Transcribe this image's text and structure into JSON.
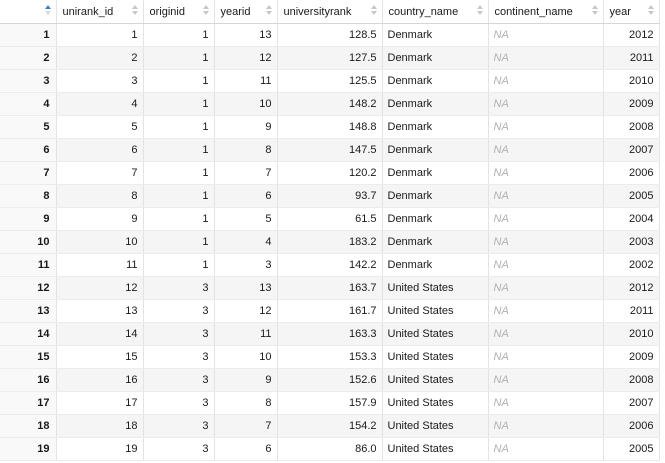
{
  "columns": [
    {
      "key": "unirank_id",
      "label": "unirank_id"
    },
    {
      "key": "originid",
      "label": "originid"
    },
    {
      "key": "yearid",
      "label": "yearid"
    },
    {
      "key": "universityrank",
      "label": "universityrank"
    },
    {
      "key": "country_name",
      "label": "country_name"
    },
    {
      "key": "continent_name",
      "label": "continent_name"
    },
    {
      "key": "year",
      "label": "year"
    }
  ],
  "rows": [
    {
      "idx": "1",
      "unirank_id": "1",
      "originid": "1",
      "yearid": "13",
      "universityrank": "128.5",
      "country_name": "Denmark",
      "continent_name": "NA",
      "year": "2012"
    },
    {
      "idx": "2",
      "unirank_id": "2",
      "originid": "1",
      "yearid": "12",
      "universityrank": "127.5",
      "country_name": "Denmark",
      "continent_name": "NA",
      "year": "2011"
    },
    {
      "idx": "3",
      "unirank_id": "3",
      "originid": "1",
      "yearid": "11",
      "universityrank": "125.5",
      "country_name": "Denmark",
      "continent_name": "NA",
      "year": "2010"
    },
    {
      "idx": "4",
      "unirank_id": "4",
      "originid": "1",
      "yearid": "10",
      "universityrank": "148.2",
      "country_name": "Denmark",
      "continent_name": "NA",
      "year": "2009"
    },
    {
      "idx": "5",
      "unirank_id": "5",
      "originid": "1",
      "yearid": "9",
      "universityrank": "148.8",
      "country_name": "Denmark",
      "continent_name": "NA",
      "year": "2008"
    },
    {
      "idx": "6",
      "unirank_id": "6",
      "originid": "1",
      "yearid": "8",
      "universityrank": "147.5",
      "country_name": "Denmark",
      "continent_name": "NA",
      "year": "2007"
    },
    {
      "idx": "7",
      "unirank_id": "7",
      "originid": "1",
      "yearid": "7",
      "universityrank": "120.2",
      "country_name": "Denmark",
      "continent_name": "NA",
      "year": "2006"
    },
    {
      "idx": "8",
      "unirank_id": "8",
      "originid": "1",
      "yearid": "6",
      "universityrank": "93.7",
      "country_name": "Denmark",
      "continent_name": "NA",
      "year": "2005"
    },
    {
      "idx": "9",
      "unirank_id": "9",
      "originid": "1",
      "yearid": "5",
      "universityrank": "61.5",
      "country_name": "Denmark",
      "continent_name": "NA",
      "year": "2004"
    },
    {
      "idx": "10",
      "unirank_id": "10",
      "originid": "1",
      "yearid": "4",
      "universityrank": "183.2",
      "country_name": "Denmark",
      "continent_name": "NA",
      "year": "2003"
    },
    {
      "idx": "11",
      "unirank_id": "11",
      "originid": "1",
      "yearid": "3",
      "universityrank": "142.2",
      "country_name": "Denmark",
      "continent_name": "NA",
      "year": "2002"
    },
    {
      "idx": "12",
      "unirank_id": "12",
      "originid": "3",
      "yearid": "13",
      "universityrank": "163.7",
      "country_name": "United States",
      "continent_name": "NA",
      "year": "2012"
    },
    {
      "idx": "13",
      "unirank_id": "13",
      "originid": "3",
      "yearid": "12",
      "universityrank": "161.7",
      "country_name": "United States",
      "continent_name": "NA",
      "year": "2011"
    },
    {
      "idx": "14",
      "unirank_id": "14",
      "originid": "3",
      "yearid": "11",
      "universityrank": "163.3",
      "country_name": "United States",
      "continent_name": "NA",
      "year": "2010"
    },
    {
      "idx": "15",
      "unirank_id": "15",
      "originid": "3",
      "yearid": "10",
      "universityrank": "153.3",
      "country_name": "United States",
      "continent_name": "NA",
      "year": "2009"
    },
    {
      "idx": "16",
      "unirank_id": "16",
      "originid": "3",
      "yearid": "9",
      "universityrank": "152.6",
      "country_name": "United States",
      "continent_name": "NA",
      "year": "2008"
    },
    {
      "idx": "17",
      "unirank_id": "17",
      "originid": "3",
      "yearid": "8",
      "universityrank": "157.9",
      "country_name": "United States",
      "continent_name": "NA",
      "year": "2007"
    },
    {
      "idx": "18",
      "unirank_id": "18",
      "originid": "3",
      "yearid": "7",
      "universityrank": "154.2",
      "country_name": "United States",
      "continent_name": "NA",
      "year": "2006"
    },
    {
      "idx": "19",
      "unirank_id": "19",
      "originid": "3",
      "yearid": "6",
      "universityrank": "86.0",
      "country_name": "United States",
      "continent_name": "NA",
      "year": "2005"
    }
  ],
  "icons": {
    "sort": "sort-arrows-icon"
  },
  "colors": {
    "sort_active": "#3b7bd4",
    "na_text": "#b0b0b0",
    "row_stripe": "#f5f5f5"
  }
}
